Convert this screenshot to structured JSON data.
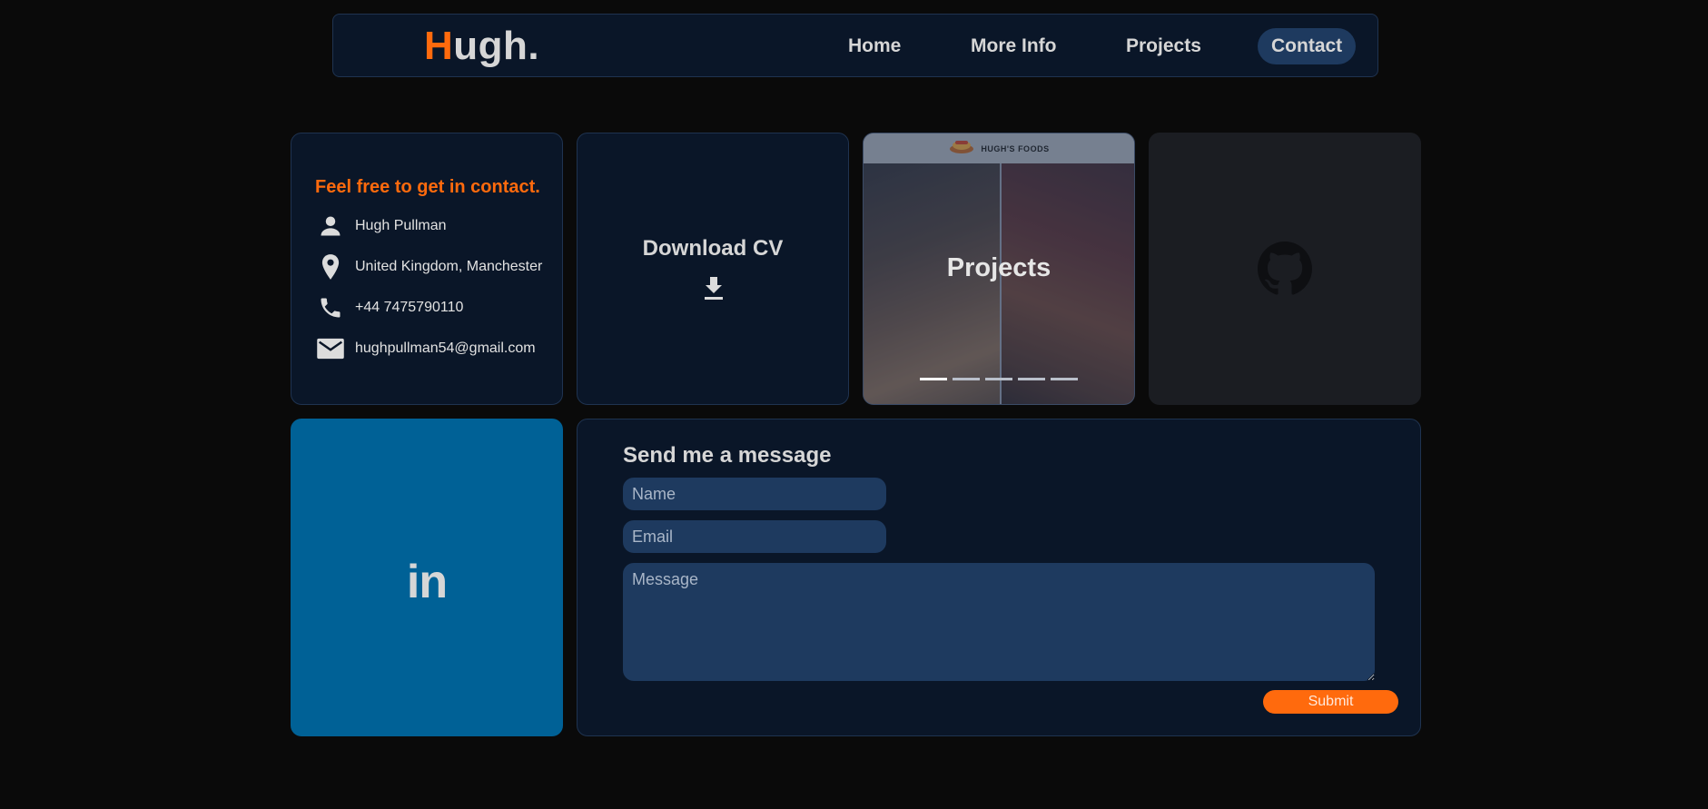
{
  "nav": {
    "logo_first": "H",
    "logo_rest": "ugh.",
    "links": [
      {
        "label": "Home"
      },
      {
        "label": "More Info"
      },
      {
        "label": "Projects"
      },
      {
        "label": "Contact"
      }
    ],
    "active": "Contact"
  },
  "contact": {
    "heading": "Feel free to get in contact.",
    "rows": [
      {
        "icon": "person-icon",
        "text": "Hugh Pullman"
      },
      {
        "icon": "location-pin-icon",
        "text": "United Kingdom, Manchester"
      },
      {
        "icon": "phone-icon",
        "text": "+44 7475790110"
      },
      {
        "icon": "mail-icon",
        "text": "hughpullman54@gmail.com"
      }
    ]
  },
  "cv": {
    "label": "Download CV",
    "icon": "download-icon"
  },
  "projects": {
    "brand": "HUGH'S FOODS",
    "title": "Projects",
    "slides": 5,
    "active_slide": 1
  },
  "github": {
    "icon": "github-icon"
  },
  "linkedin": {
    "text": "in",
    "icon": "linkedin-icon"
  },
  "message": {
    "title": "Send me a message",
    "name_placeholder": "Name",
    "email_placeholder": "Email",
    "message_placeholder": "Message",
    "submit_label": "Submit"
  },
  "colors": {
    "accent": "#ff6a0d",
    "card_bg": "#0a1628",
    "field_bg": "#1e3a5f",
    "linkedin_bg": "#006196",
    "page_bg": "#0a0a0a"
  }
}
